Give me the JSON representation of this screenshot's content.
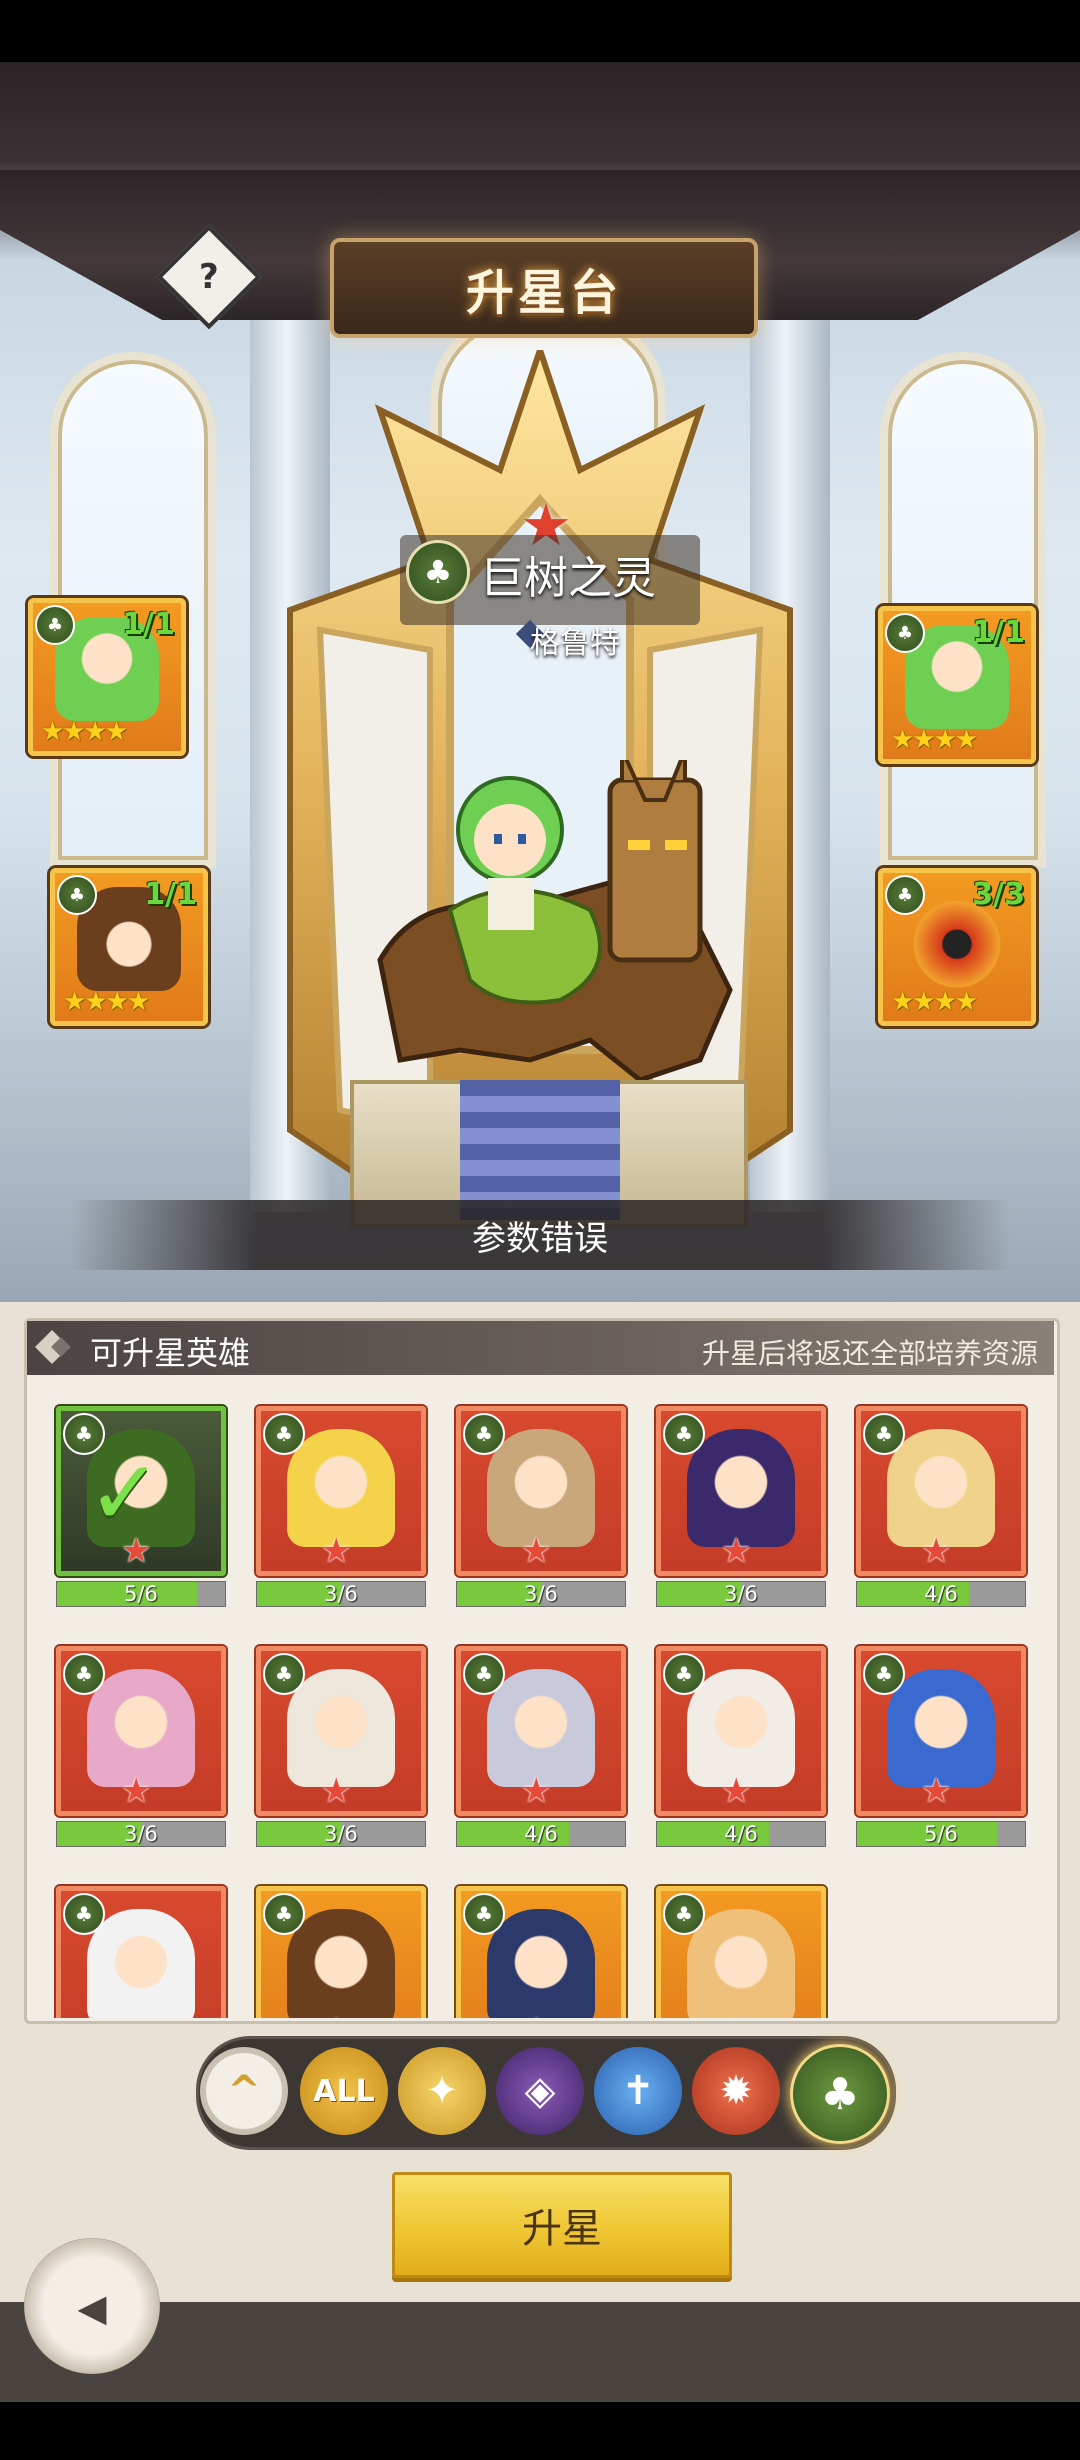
{
  "header": {
    "title": "升星台",
    "help_label": "?"
  },
  "hero": {
    "name": "巨树之灵",
    "subtitle": "格鲁特",
    "element": "nature-tree-icon",
    "status_text": "参数错误"
  },
  "material_slots": [
    {
      "count": "1/1",
      "stars": "★★★★",
      "side": "left"
    },
    {
      "count": "1/1",
      "stars": "★★★★",
      "side": "left"
    },
    {
      "count": "1/1",
      "stars": "★★★★",
      "side": "right"
    },
    {
      "count": "3/3",
      "stars": "★★★★",
      "side": "right"
    }
  ],
  "list": {
    "title": "可升星英雄",
    "hint": "升星后将返还全部培养资源",
    "heroes": [
      {
        "progress": "5/6",
        "value": 0.833,
        "selected": true,
        "frame": "red"
      },
      {
        "progress": "3/6",
        "value": 0.5,
        "selected": false,
        "frame": "red"
      },
      {
        "progress": "3/6",
        "value": 0.5,
        "selected": false,
        "frame": "red"
      },
      {
        "progress": "3/6",
        "value": 0.5,
        "selected": false,
        "frame": "red"
      },
      {
        "progress": "4/6",
        "value": 0.667,
        "selected": false,
        "frame": "red"
      },
      {
        "progress": "3/6",
        "value": 0.5,
        "selected": false,
        "frame": "red"
      },
      {
        "progress": "3/6",
        "value": 0.5,
        "selected": false,
        "frame": "red"
      },
      {
        "progress": "4/6",
        "value": 0.667,
        "selected": false,
        "frame": "red"
      },
      {
        "progress": "4/6",
        "value": 0.667,
        "selected": false,
        "frame": "red"
      },
      {
        "progress": "5/6",
        "value": 0.833,
        "selected": false,
        "frame": "red"
      },
      {
        "progress": "",
        "value": 0,
        "selected": false,
        "frame": "red"
      },
      {
        "progress": "",
        "value": 0,
        "selected": false,
        "frame": "gold"
      },
      {
        "progress": "",
        "value": 0,
        "selected": false,
        "frame": "gold"
      },
      {
        "progress": "",
        "value": 0,
        "selected": false,
        "frame": "gold"
      }
    ]
  },
  "filters": [
    {
      "name": "collapse-filter-icon",
      "label": "^"
    },
    {
      "name": "all-filter",
      "label": "ALL"
    },
    {
      "name": "light-element-icon",
      "label": "✦"
    },
    {
      "name": "dark-element-icon",
      "label": "◈"
    },
    {
      "name": "water-element-icon",
      "label": "✝"
    },
    {
      "name": "fire-element-icon",
      "label": "✹"
    },
    {
      "name": "nature-element-icon",
      "label": "♣"
    }
  ],
  "actions": {
    "upgrade_label": "升星",
    "back_label": "◂"
  },
  "colors": {
    "accent_gold": "#efc633",
    "progress_green": "#78c93b",
    "card_red": "#c43c27",
    "card_gold": "#e17b1a"
  }
}
